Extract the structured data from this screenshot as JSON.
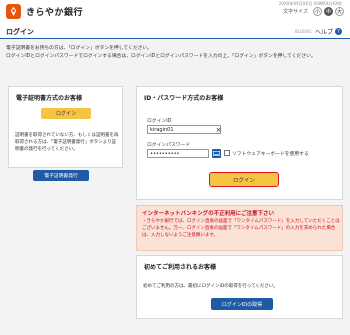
{
  "header": {
    "bank_name": "きらやか銀行",
    "datetime": "20XX年XX月XX日 XX時XX分XX秒",
    "font_size_label": "文字サイズ",
    "font_sizes": [
      "小",
      "中",
      "大"
    ]
  },
  "title_bar": {
    "title": "ログイン",
    "screen_id": "BLGI001",
    "help": "ヘルプ",
    "help_icon_char": "?"
  },
  "intro": {
    "line1": "電子証明書をお持ちの方は、「ログイン」ボタンを押してください。",
    "line2": "ログインIDとログインパスワードでログインする場合は、ログインIDとログインパスワードを入力の上、「ログイン」ボタンを押してください。"
  },
  "cert_panel": {
    "title": "電子証明書方式のお客様",
    "login_label": "ログイン",
    "description": "証明書を取得されていない方、もしくは証明書を再取得される方は、「電子証明書発行」ボタンより証明書の発行を行ってください。",
    "issue_label": "電子証明書発行"
  },
  "id_panel": {
    "title": "ID・パスワード方式のお客様",
    "id_label": "ログインID",
    "id_value": "kiragin01",
    "clear_icon": "×",
    "password_label": "ログインパスワード",
    "password_value": "••••••••••",
    "software_keyboard_label": "ソフトウェアキーボードを使用する",
    "login_label": "ログイン"
  },
  "warning": {
    "title": "インターネットバンキングの不正利用にご注意下さい",
    "text": "・きらやか銀行では、ログイン直後の画面で「ワンタイムパスワード」を入力していただくことはございません。万一、ログイン直後の画面で「ワンタイムパスワード」の入力を求められた場合は、入力しないようご注意願います。"
  },
  "first_panel": {
    "title": "初めてご利用されるお客様",
    "description": "初めてご利用の方は、最初にログインIDの取得を行ってください。",
    "button_label": "ログインIDの取得"
  },
  "colors": {
    "brand_orange": "#e8530e",
    "primary_blue": "#1f5aa5",
    "login_yellow": "#f6c443",
    "alert_red": "#e3151b",
    "warning_bg": "#fbe2d6"
  },
  "icons": {
    "logo": "kirayaka-logo-icon",
    "help": "help-icon",
    "clear": "clear-icon",
    "keyboard": "keyboard-icon"
  }
}
